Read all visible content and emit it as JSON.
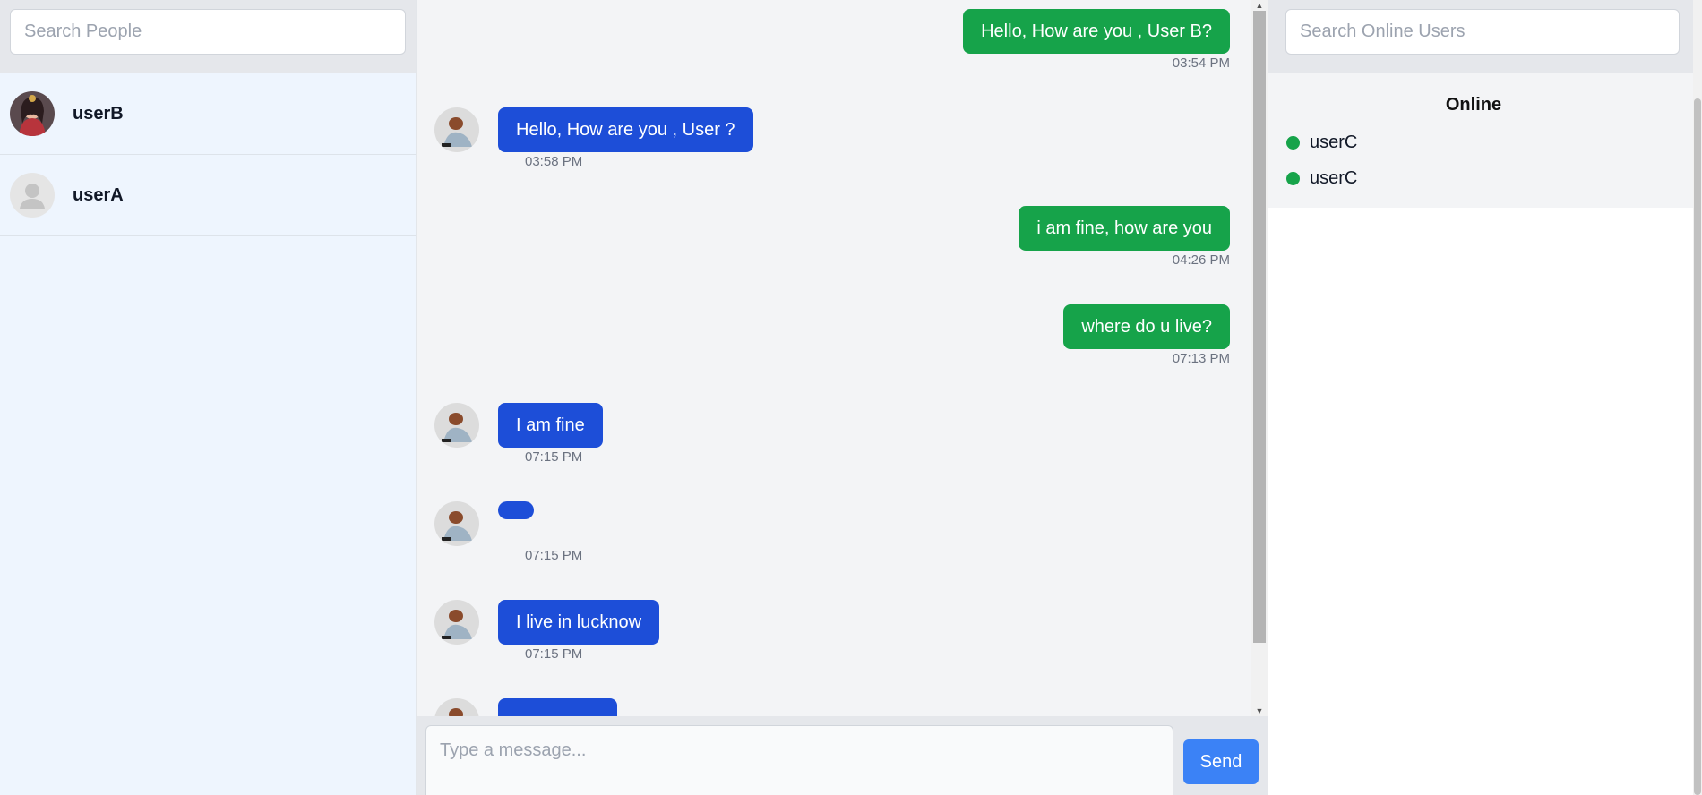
{
  "left_sidebar": {
    "search_placeholder": "Search People",
    "contacts": [
      {
        "name": "userB",
        "avatar_icon": "profile-photo"
      },
      {
        "name": "userA",
        "avatar_icon": "default-user-icon"
      }
    ]
  },
  "chat": {
    "messages": [
      {
        "direction": "outgoing",
        "text": "Hello, How are you , User B?",
        "time": "03:54 PM"
      },
      {
        "direction": "incoming",
        "text": "Hello, How are you , User ?",
        "time": "03:58 PM"
      },
      {
        "direction": "outgoing",
        "text": "i am fine, how are you",
        "time": "04:26 PM"
      },
      {
        "direction": "outgoing",
        "text": "where do u live?",
        "time": "07:13 PM"
      },
      {
        "direction": "incoming",
        "text": "I am fine",
        "time": "07:15 PM"
      },
      {
        "direction": "incoming",
        "text": "",
        "time": "07:15 PM"
      },
      {
        "direction": "incoming",
        "text": "I live in lucknow",
        "time": "07:15 PM"
      }
    ],
    "composer": {
      "placeholder": "Type a message...",
      "send_label": "Send"
    }
  },
  "right_panel": {
    "search_placeholder": "Search Online Users",
    "online_title": "Online",
    "online_users": [
      "userC",
      "userC"
    ],
    "online_status_color": "#16a34a"
  },
  "colors": {
    "outgoing_bubble": "#16a34a",
    "incoming_bubble": "#1d4ed8",
    "send_button": "#3b82f6"
  }
}
